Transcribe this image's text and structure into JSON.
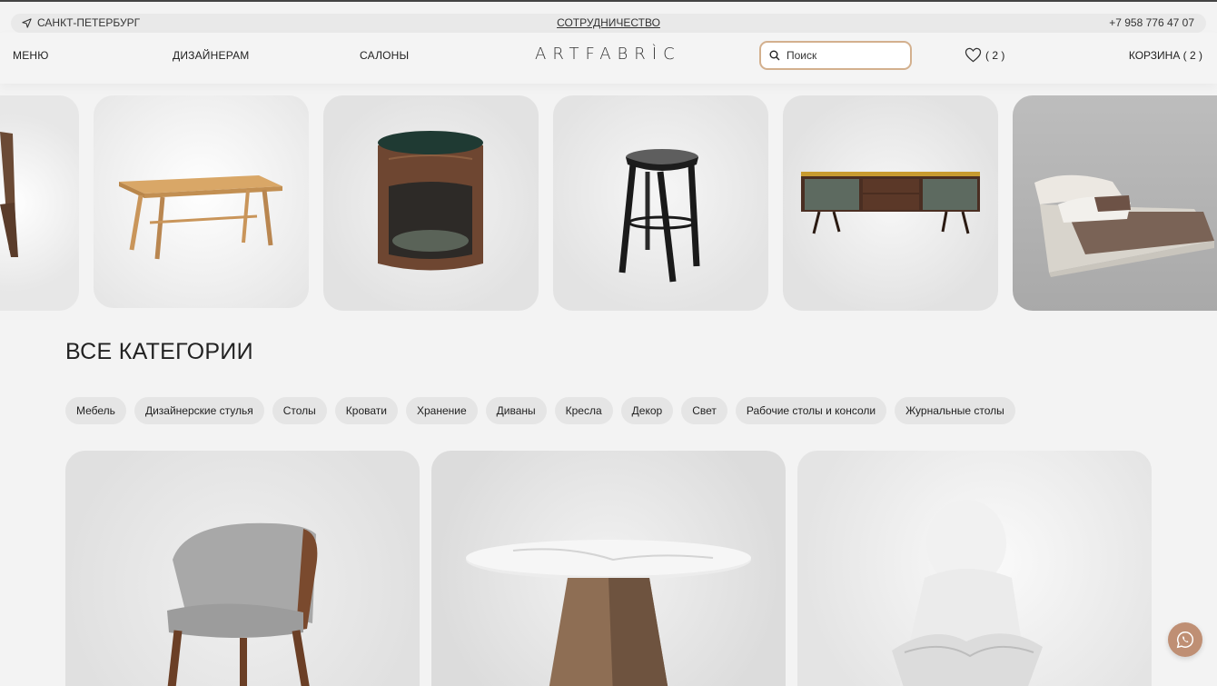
{
  "topbar": {
    "city": "САНКТ-ПЕТЕРБУРГ",
    "cooperation": "СОТРУДНИЧЕСТВО",
    "phone": "+7 958 776 47 07"
  },
  "header": {
    "menu": "МЕНЮ",
    "designers": "ДИЗАЙНЕРАМ",
    "salons": "САЛОНЫ",
    "logo": "ARTFABRÌC",
    "search_placeholder": "Поиск",
    "favorites_count": "( 2 )",
    "cart": "КОРЗИНА ( 2 )"
  },
  "carousel": {
    "items": [
      {
        "icon": "chair-image"
      },
      {
        "icon": "dining-table-image"
      },
      {
        "icon": "bedside-table-image"
      },
      {
        "icon": "bar-stool-image"
      },
      {
        "icon": "sideboard-image"
      },
      {
        "icon": "bed-image"
      }
    ]
  },
  "categories": {
    "title": "ВСЕ КАТЕГОРИИ",
    "chips": [
      "Мебель",
      "Дизайнерские стулья",
      "Столы",
      "Кровати",
      "Хранение",
      "Диваны",
      "Кресла",
      "Декор",
      "Свет",
      "Рабочие столы и консоли",
      "Журнальные столы"
    ]
  },
  "featured": [
    {
      "icon": "upholstered-chair-image"
    },
    {
      "icon": "marble-round-table-image"
    },
    {
      "icon": "reading-figure-sculpture-image"
    }
  ],
  "colors": {
    "accent": "#d3b08e",
    "chat_button": "#bf8f74",
    "background": "#f3f3f3",
    "chip": "#e5e5e5"
  }
}
